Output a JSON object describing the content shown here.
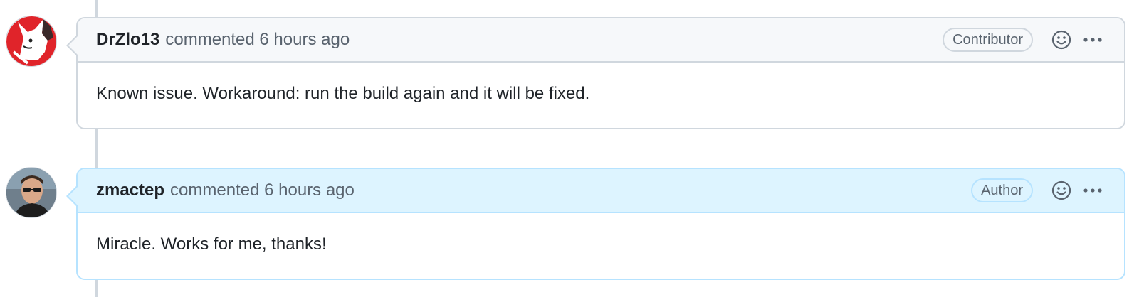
{
  "comments": [
    {
      "username": "DrZlo13",
      "meta": "commented 6 hours ago",
      "badge": "Contributor",
      "body": "Known issue. Workaround: run the build again and it will be fixed.",
      "avatar_icon": "fox-avatar",
      "colors": {
        "header_bg": "#f6f8fa",
        "border": "#d0d7de"
      }
    },
    {
      "username": "zmactep",
      "meta": "commented 6 hours ago",
      "badge": "Author",
      "body": "Miracle. Works for me, thanks!",
      "avatar_icon": "user-photo-avatar",
      "colors": {
        "header_bg": "#ddf4ff",
        "border": "#b6e3ff"
      }
    }
  ],
  "icons": {
    "reaction": "smiley-icon",
    "more": "kebab-horizontal-icon"
  }
}
